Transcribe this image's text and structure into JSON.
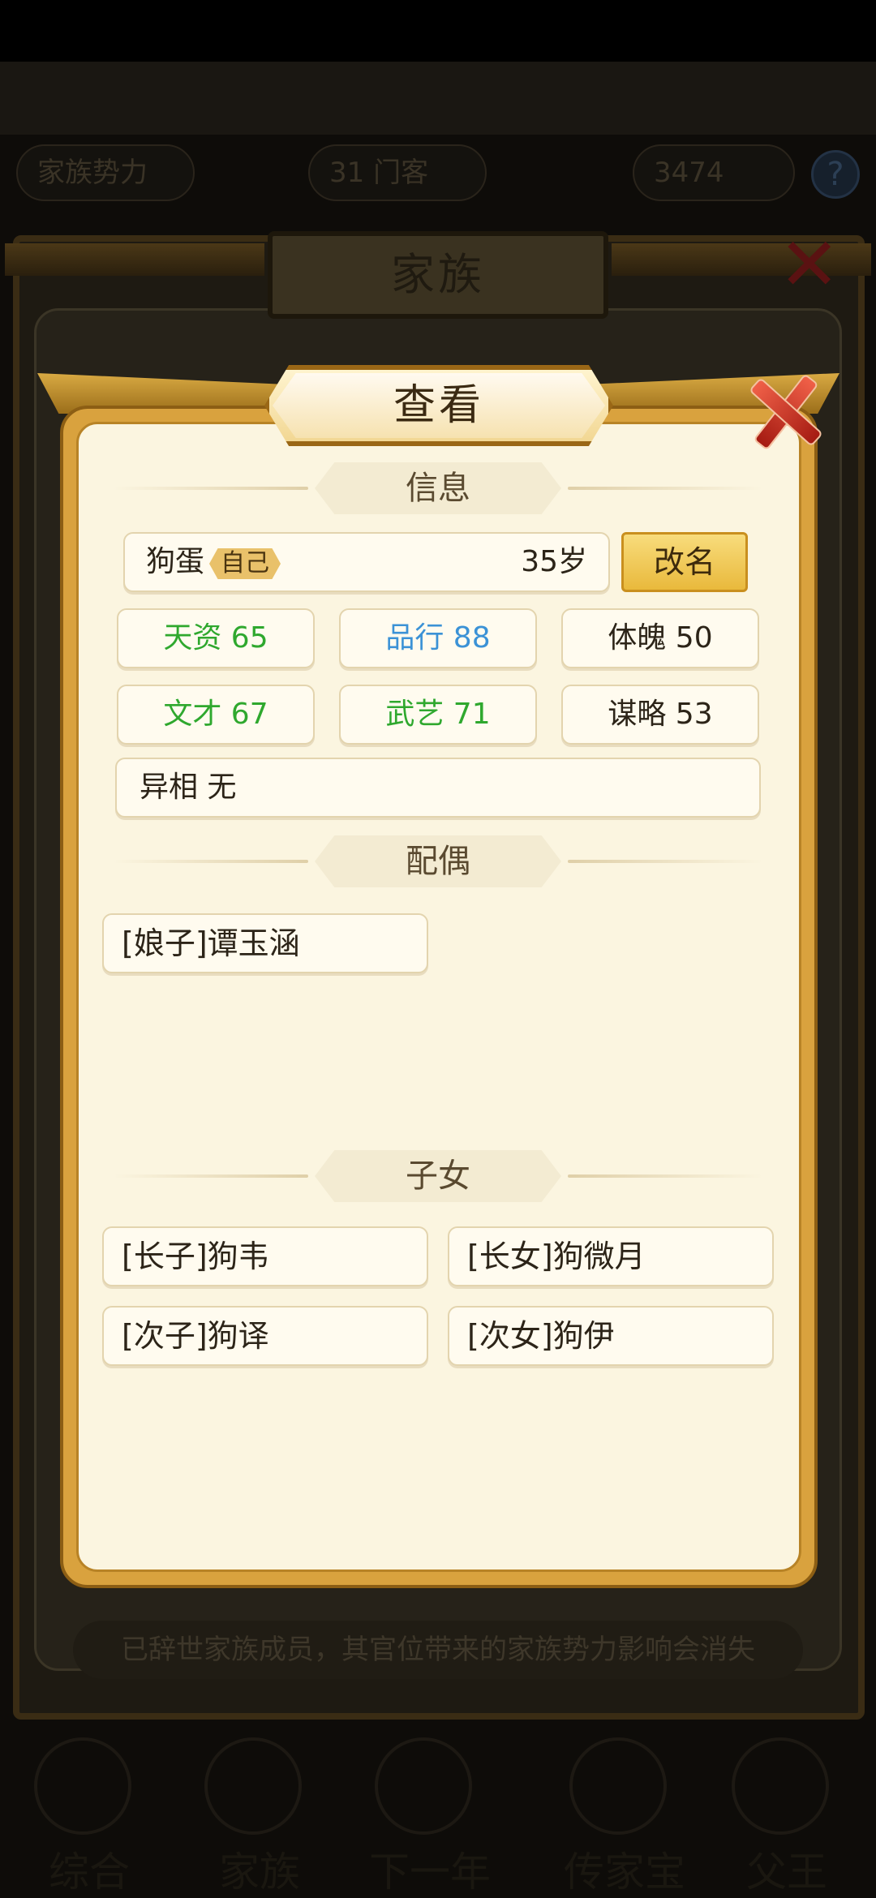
{
  "background": {
    "top_row": [
      "家族势力",
      "31 门客",
      "3474"
    ],
    "panel_title": "家族",
    "notice": "已辞世家族成员，其官位带来的家族势力影响会消失",
    "nav": [
      "综合",
      "家族",
      "下一年",
      "传家宝",
      "父王"
    ]
  },
  "modal": {
    "title": "查看",
    "sections": {
      "info": "信息",
      "spouse": "配偶",
      "children": "子女"
    },
    "person": {
      "name": "狗蛋",
      "self_tag": "自己",
      "age": "35岁",
      "rename_label": "改名"
    },
    "stats": [
      {
        "label": "天资 65",
        "color": "#2fa82e"
      },
      {
        "label": "品行 88",
        "color": "#3b92d6"
      },
      {
        "label": "体魄 50",
        "color": "#2c2418"
      },
      {
        "label": "文才 67",
        "color": "#2fa82e"
      },
      {
        "label": "武艺 71",
        "color": "#2fa82e"
      },
      {
        "label": "谋略 53",
        "color": "#2c2418"
      }
    ],
    "mutation": "异相 无",
    "spouses": [
      "[娘子]谭玉涵"
    ],
    "children": [
      "[长子]狗韦",
      "[长女]狗微月",
      "[次子]狗译",
      "[次女]狗伊"
    ]
  }
}
